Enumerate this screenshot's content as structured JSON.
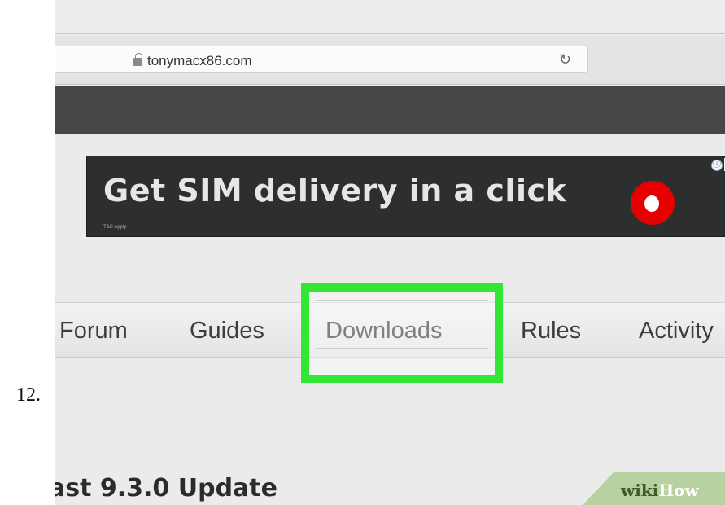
{
  "step": {
    "number": "12."
  },
  "browser": {
    "url": "tonymacx86.com",
    "lock_icon": "lock-icon",
    "reload_icon": "reload-icon"
  },
  "ad": {
    "headline": "Get SIM delivery in a click",
    "fine_print": "T&C Apply",
    "adchoices_glyph": "ⓘ",
    "close_glyph": "✕"
  },
  "nav": {
    "items": [
      {
        "label": "Forum"
      },
      {
        "label": "Guides"
      },
      {
        "label": "Downloads",
        "highlighted": true
      },
      {
        "label": "Rules"
      },
      {
        "label": "Activity"
      }
    ]
  },
  "page": {
    "headline": "ast 9.3.0 Update"
  },
  "watermark": {
    "wiki": "wiki",
    "how": "How"
  },
  "colors": {
    "highlight": "#32e632",
    "ad_background": "#2c2f2e",
    "vodafone_red": "#e60000",
    "toolbar_dark": "#474747"
  }
}
